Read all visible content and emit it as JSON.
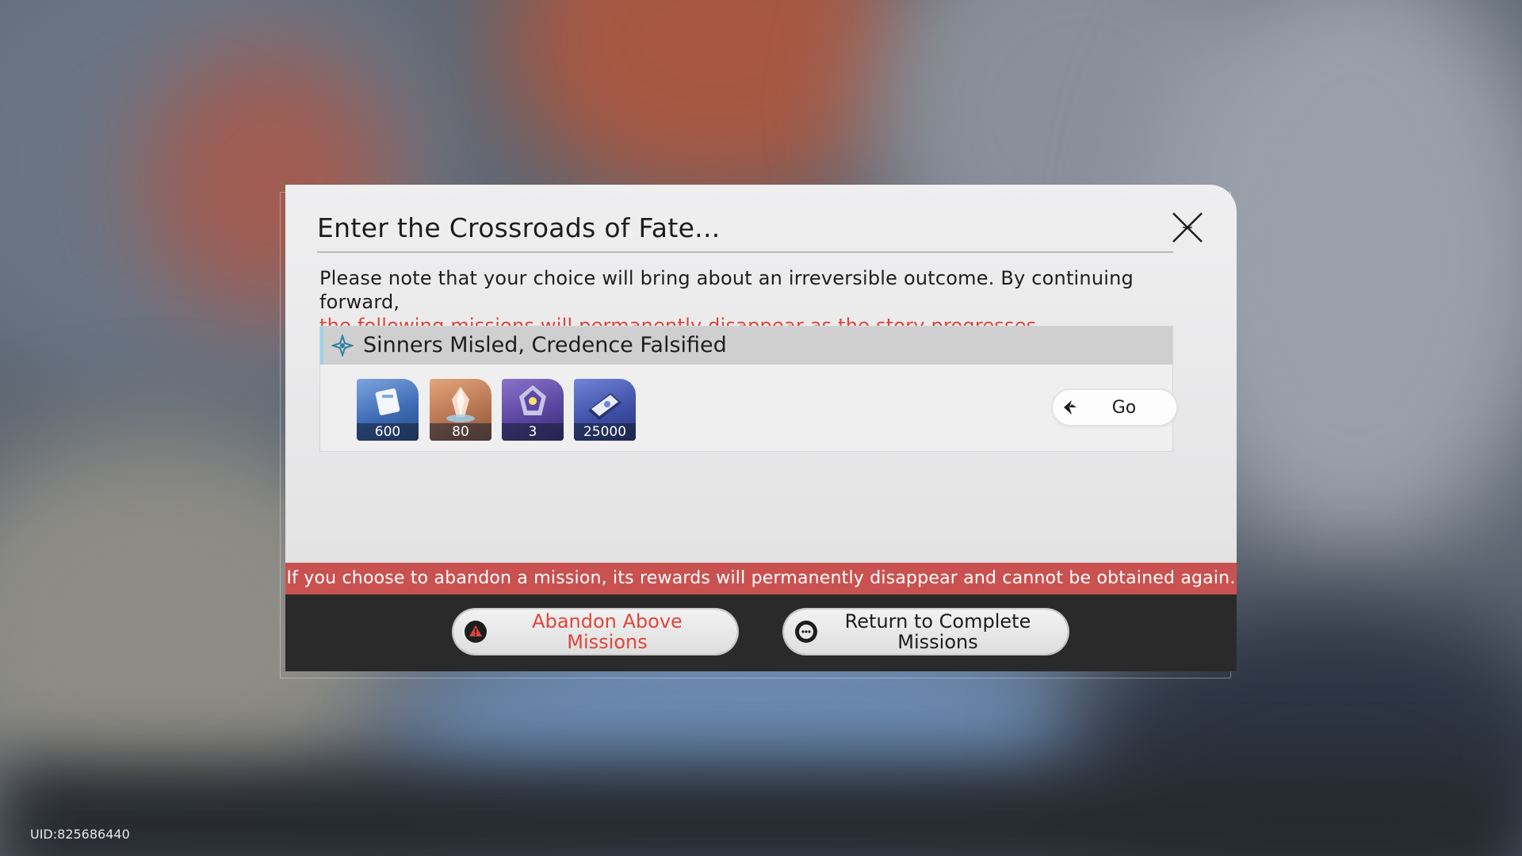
{
  "uid": "UID:825686440",
  "dialog": {
    "title": "Enter the Crossroads of Fate...",
    "note_normal": "Please note that your choice will bring about an irreversible outcome. By continuing forward,",
    "note_warning": "the following missions will permanently disappear as the story progresses.",
    "mission": {
      "title": "Sinners Misled, Credence Falsified",
      "rewards": [
        {
          "icon": "stellar-jade-icon",
          "quantity": "600"
        },
        {
          "icon": "crystal-icon",
          "quantity": "80"
        },
        {
          "icon": "exp-material-icon",
          "quantity": "3"
        },
        {
          "icon": "credit-icon",
          "quantity": "25000"
        }
      ],
      "go_label": "Go"
    },
    "alert": "If you choose to abandon a mission, its rewards will permanently disappear and cannot be obtained again.",
    "abandon_label": "Abandon Above Missions",
    "return_label": "Return to Complete Missions"
  },
  "colors": {
    "warning_red": "#e0453a",
    "alert_bar": "#c95250",
    "footer": "#2a2a2a"
  }
}
